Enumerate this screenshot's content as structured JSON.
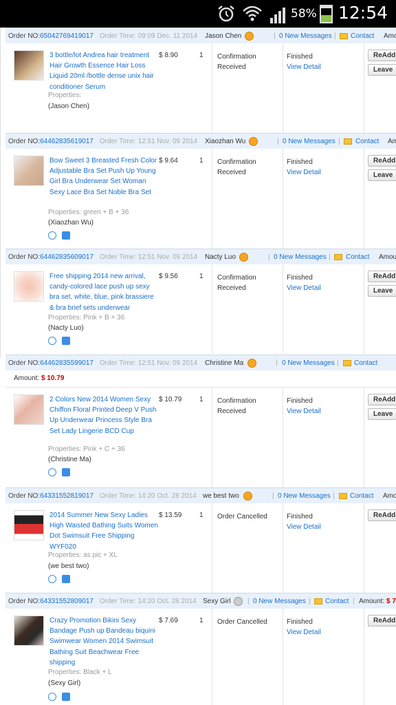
{
  "status_bar": {
    "battery_pct": "58%",
    "time": "12:54"
  },
  "orders": [
    {
      "order_no_label": "Order NO:",
      "order_no": "65042769419017",
      "order_time": "Order Time: 09:09 Dec. 11 2014",
      "buyer": "Jason Chen",
      "messages": "0 New Messages",
      "contact": "Contact",
      "amount_label": "Amo",
      "title": "3 bottle/lot Andrea hair treatment Hair Growth Essence Hair Loss Liquid 20ml /bottle dense unix hair conditioner Serum",
      "properties": "Properties:",
      "buyer_paren": "(Jason Chen)",
      "price": "$ 8.90",
      "qty": "1",
      "order_status": "Confirmation Received",
      "final_status": "Finished",
      "view_detail": "View Detail",
      "btn1": "ReAdd T",
      "btn2": "Leave"
    },
    {
      "order_no_label": "Order NO:",
      "order_no": "64462835619017",
      "order_time": "Order Time: 12:51 Nov. 09 2014",
      "buyer": "Xiaozhan Wu",
      "messages": "0 New Messages",
      "contact": "Contact",
      "amount_label": "Am",
      "title": "Bow Sweet 3 Breasted Fresh Color Adjustable Bra Set Push Up Young Girl Bra Underwear Set Woman Sexy Lace Bra Set Noble Bra Set",
      "properties": "Properties: green  + B  + 36",
      "buyer_paren": "(Xiaozhan Wu)",
      "price": "$ 9.64",
      "qty": "1",
      "order_status": "Confirmation Received",
      "final_status": "Finished",
      "view_detail": "View Detail",
      "btn1": "ReAdd T",
      "btn2": "Leave"
    },
    {
      "order_no_label": "Order NO:",
      "order_no": "64462835609017",
      "order_time": "Order Time: 12:51 Nov. 09 2014",
      "buyer": "Nacty Luo",
      "messages": "0 New Messages",
      "contact": "Contact",
      "amount_label": "Amou",
      "title": "Free shipping 2014 new arrival, candy-colored lace push up sexy bra set, white, blue, pink brassiere & bra brief sets underwear",
      "properties": "Properties: Pink  + B  + 36",
      "buyer_paren": "(Nacty Luo)",
      "price": "$ 9.56",
      "qty": "1",
      "order_status": "Confirmation Received",
      "final_status": "Finished",
      "view_detail": "View Detail",
      "btn1": "ReAdd T",
      "btn2": "Leave"
    },
    {
      "order_no_label": "Order NO:",
      "order_no": "64462835599017",
      "order_time": "Order Time: 12:51 Nov. 09 2014",
      "buyer": "Christine Ma",
      "messages": "0 New Messages",
      "contact": "Contact",
      "amount_line_label": "Amount:",
      "amount_line_value": "$ 10.79",
      "title": "2 Colors New 2014 Women Sexy Chiffon Floral Printed Deep V Push Up Underwear Princess Style Bra Set Lady Lingerie BCD Cup",
      "properties": "Properties: Pink  + C  + 36",
      "buyer_paren": "(Christine Ma)",
      "price": "$ 10.79",
      "qty": "1",
      "order_status": "Confirmation Received",
      "final_status": "Finished",
      "view_detail": "View Detail",
      "btn1": "ReAdd T",
      "btn2": "Leave"
    },
    {
      "order_no_label": "Order NO:",
      "order_no": "64331552819017",
      "order_time": "Order Time: 14:20 Oct. 28 2014",
      "buyer": "we best two",
      "messages": "0 New Messages",
      "contact": "Contact",
      "amount_label": "Amo",
      "title": "2014 Summer New Sexy Ladies High Waisted Bathing Suits Women Dot Swimsuit Free Shipping WYF020",
      "properties": "Properties: as pic  + XL",
      "buyer_paren": "(we best two)",
      "price": "$ 13.59",
      "qty": "1",
      "order_status": "Order Cancelled",
      "final_status": "Finished",
      "view_detail": "View Detail",
      "btn1": "ReAdd T"
    },
    {
      "order_no_label": "Order NO:",
      "order_no": "64331552809017",
      "order_time": "Order Time: 14:20 Oct. 28 2014",
      "buyer": "Sexy Girl",
      "messages": "0 New Messages",
      "contact": "Contact",
      "amount_label": "Amount:",
      "amount_value": "$ 7",
      "title": "Crazy Promotion Bikini Sexy Bandage Push up Bandeau biquini Swimwear Women 2014 Swimsuit Bathing Suit Beachwear Free shipping",
      "properties": "Properties: Black  + L",
      "buyer_paren": "(Sexy Girl)",
      "price": "$ 7.69",
      "qty": "1",
      "order_status": "Order Cancelled",
      "final_status": "Finished",
      "view_detail": "View Detail",
      "btn1": "ReAdd T"
    }
  ]
}
